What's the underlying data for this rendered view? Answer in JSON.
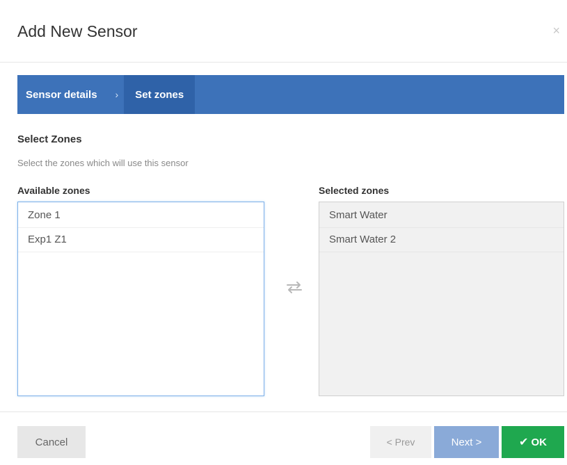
{
  "dialog": {
    "title": "Add New Sensor",
    "close_glyph": "×"
  },
  "wizard": {
    "steps": [
      {
        "label": "Sensor details",
        "active": false
      },
      {
        "label": "Set zones",
        "active": true
      }
    ],
    "separator_glyph": "›"
  },
  "section": {
    "title": "Select Zones",
    "description": "Select the zones which will use this sensor"
  },
  "available": {
    "label": "Available zones",
    "items": [
      "Zone 1",
      "Exp1 Z1"
    ]
  },
  "selected": {
    "label": "Selected zones",
    "items": [
      "Smart Water",
      "Smart Water 2"
    ]
  },
  "swap_icon": "swap-arrows-icon",
  "footer": {
    "cancel_label": "Cancel",
    "prev_label": "< Prev",
    "next_label": "Next >",
    "ok_label": "OK",
    "ok_icon": "check-icon",
    "check_glyph": "✔"
  },
  "colors": {
    "wizard_bar": "#3d72b9",
    "wizard_active": "#2f62a8",
    "ok_button": "#1fa84f",
    "next_button": "#8aaad8",
    "list_focus_border": "#7fb0e8"
  }
}
